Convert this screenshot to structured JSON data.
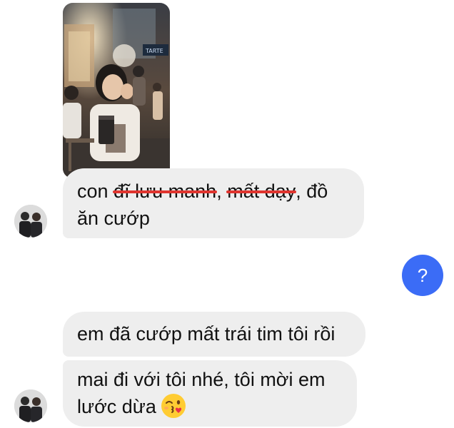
{
  "messages": {
    "photo": {
      "label": "TARTE",
      "icon": "photo-message"
    },
    "msg1": {
      "part_a": "con ",
      "struck_1": "đĩ lưu manh",
      "part_b": ", ",
      "struck_2": "mất dạy",
      "part_c": ", đồ",
      "line2": "ăn cướp"
    },
    "msg2": {
      "text": "em đã cướp mất trái tim tôi rồi"
    },
    "msg3": {
      "line1": "mai đi với tôi nhé, tôi mời em",
      "line2": "lước dừa",
      "emoji": "kiss-wink-emoji"
    }
  },
  "reply_button": {
    "label": "?"
  },
  "colors": {
    "bubble_bg": "#eeeeee",
    "strike": "#e0352f",
    "reply_blue": "#3b6cf6"
  }
}
